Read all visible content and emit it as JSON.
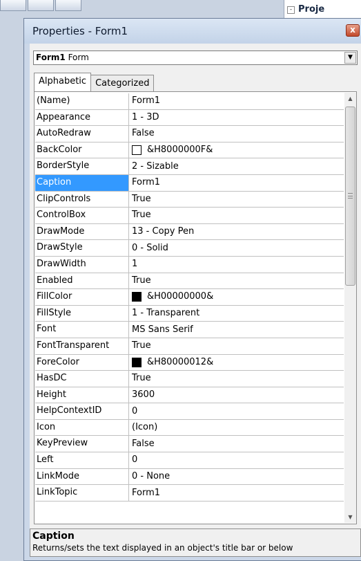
{
  "background": {
    "right_pane_label": "Proje",
    "tree_toggle": "-"
  },
  "window": {
    "title": "Properties - Form1",
    "close_glyph": "x"
  },
  "object_selector": {
    "object_name": "Form1",
    "object_type": "Form"
  },
  "tabs": [
    {
      "label": "Alphabetic"
    },
    {
      "label": "Categorized"
    }
  ],
  "properties": [
    {
      "name": "(Name)",
      "value": "Form1"
    },
    {
      "name": "Appearance",
      "value": "1 - 3D"
    },
    {
      "name": "AutoRedraw",
      "value": "False"
    },
    {
      "name": "BackColor",
      "value": "&H8000000F&",
      "swatch": "#ffffff"
    },
    {
      "name": "BorderStyle",
      "value": "2 - Sizable"
    },
    {
      "name": "Caption",
      "value": "Form1",
      "selected": true
    },
    {
      "name": "ClipControls",
      "value": "True"
    },
    {
      "name": "ControlBox",
      "value": "True"
    },
    {
      "name": "DrawMode",
      "value": "13 - Copy Pen"
    },
    {
      "name": "DrawStyle",
      "value": "0 - Solid"
    },
    {
      "name": "DrawWidth",
      "value": "1"
    },
    {
      "name": "Enabled",
      "value": "True"
    },
    {
      "name": "FillColor",
      "value": "&H00000000&",
      "swatch": "#000000"
    },
    {
      "name": "FillStyle",
      "value": "1 - Transparent"
    },
    {
      "name": "Font",
      "value": "MS Sans Serif"
    },
    {
      "name": "FontTransparent",
      "value": "True"
    },
    {
      "name": "ForeColor",
      "value": "&H80000012&",
      "swatch": "#000000"
    },
    {
      "name": "HasDC",
      "value": "True"
    },
    {
      "name": "Height",
      "value": "3600"
    },
    {
      "name": "HelpContextID",
      "value": "0"
    },
    {
      "name": "Icon",
      "value": "(Icon)"
    },
    {
      "name": "KeyPreview",
      "value": "False"
    },
    {
      "name": "Left",
      "value": "0"
    },
    {
      "name": "LinkMode",
      "value": "0 - None"
    },
    {
      "name": "LinkTopic",
      "value": "Form1"
    }
  ],
  "description": {
    "title": "Caption",
    "text": "Returns/sets the text displayed in an object's title bar or below"
  },
  "colors": {
    "selection": "#3399ff"
  }
}
